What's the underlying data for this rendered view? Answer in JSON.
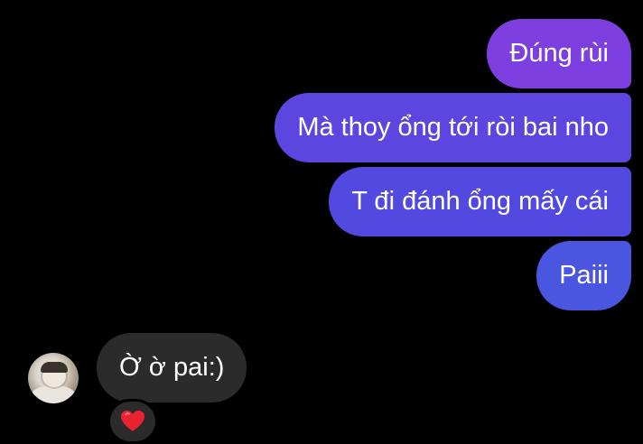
{
  "conversation": {
    "outgoing_messages": [
      {
        "text": "Đúng rùi"
      },
      {
        "text": "Mà thoy ổng tới ròi bai nho"
      },
      {
        "text": "T đi đánh ổng mấy cái"
      },
      {
        "text": "Paiii"
      }
    ],
    "incoming_message": {
      "text": "Ờ ờ pai:)",
      "reaction": "heart"
    }
  },
  "colors": {
    "background": "#000000",
    "outgoing_bubble_top": "#7d3fe0",
    "outgoing_bubble_bottom": "#4a55e0",
    "incoming_bubble": "#2b2b2b",
    "reaction_heart": "#e8232f",
    "text": "#ffffff"
  },
  "icons": {
    "reaction": "heart-icon",
    "avatar": "user-avatar"
  }
}
